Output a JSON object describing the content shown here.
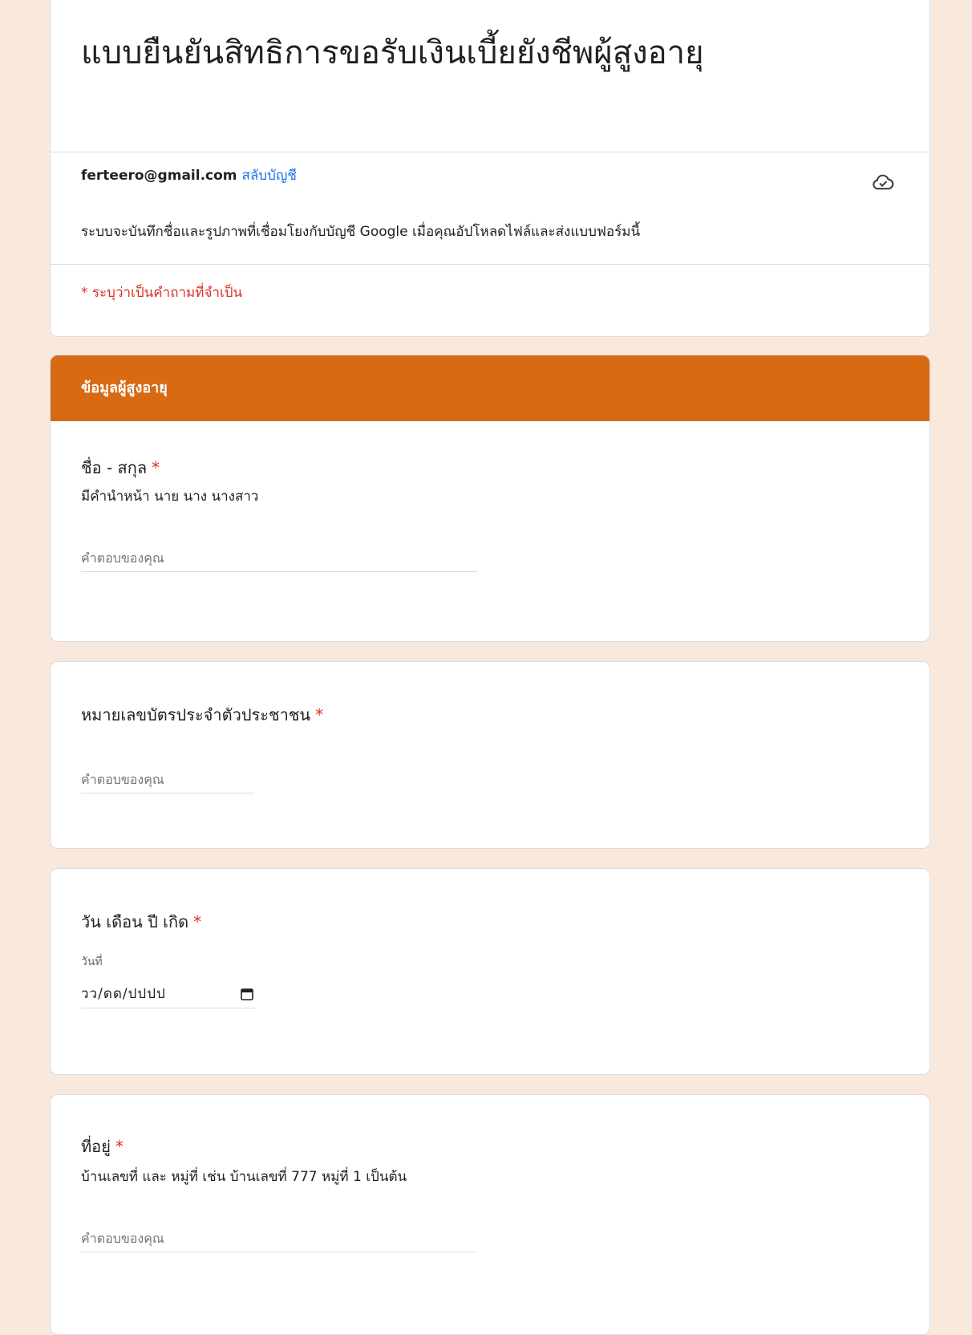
{
  "form": {
    "title": "แบบยืนยันสิทธิการขอรับเงินเบี้ยยังชีพผู้สูงอายุ",
    "account_email": "ferteero@gmail.com",
    "switch_account": "สลับบัญชี",
    "notice": "ระบบจะบันทึกชื่อและรูปภาพที่เชื่อมโยงกับบัญชี Google เมื่อคุณอัปโหลดไฟล์และส่งแบบฟอร์มนี้",
    "required_note": "* ระบุว่าเป็นคำถามที่จำเป็น",
    "cloud_icon": "cloud-done-icon"
  },
  "section": {
    "title": "ข้อมูลผู้สูงอายุ"
  },
  "questions": {
    "name": {
      "title": "ชื่อ - สกุล",
      "required": "*",
      "description": "มีคำนำหน้า นาย นาง นางสาว",
      "placeholder": "คำตอบของคุณ"
    },
    "id_card": {
      "title": "หมายเลขบัตรประจำตัวประชาชน",
      "required": "*",
      "placeholder": "คำตอบของคุณ"
    },
    "birthdate": {
      "title": "วัน เดือน ปี เกิด",
      "required": "*",
      "date_label": "วันที่",
      "date_placeholder": "วว/ดด/ปปปป"
    },
    "address": {
      "title": "ที่อยู่",
      "required": "*",
      "description": "บ้านเลขที่ และ หมู่ที่ เช่น บ้านเลขที่ 777 หมู่ที่ 1 เป็นต้น",
      "placeholder": "คำตอบของคุณ"
    }
  },
  "colors": {
    "page_bg": "#f9e9dd",
    "accent": "#d86a14",
    "required": "#d93025",
    "link": "#1a73e8"
  }
}
